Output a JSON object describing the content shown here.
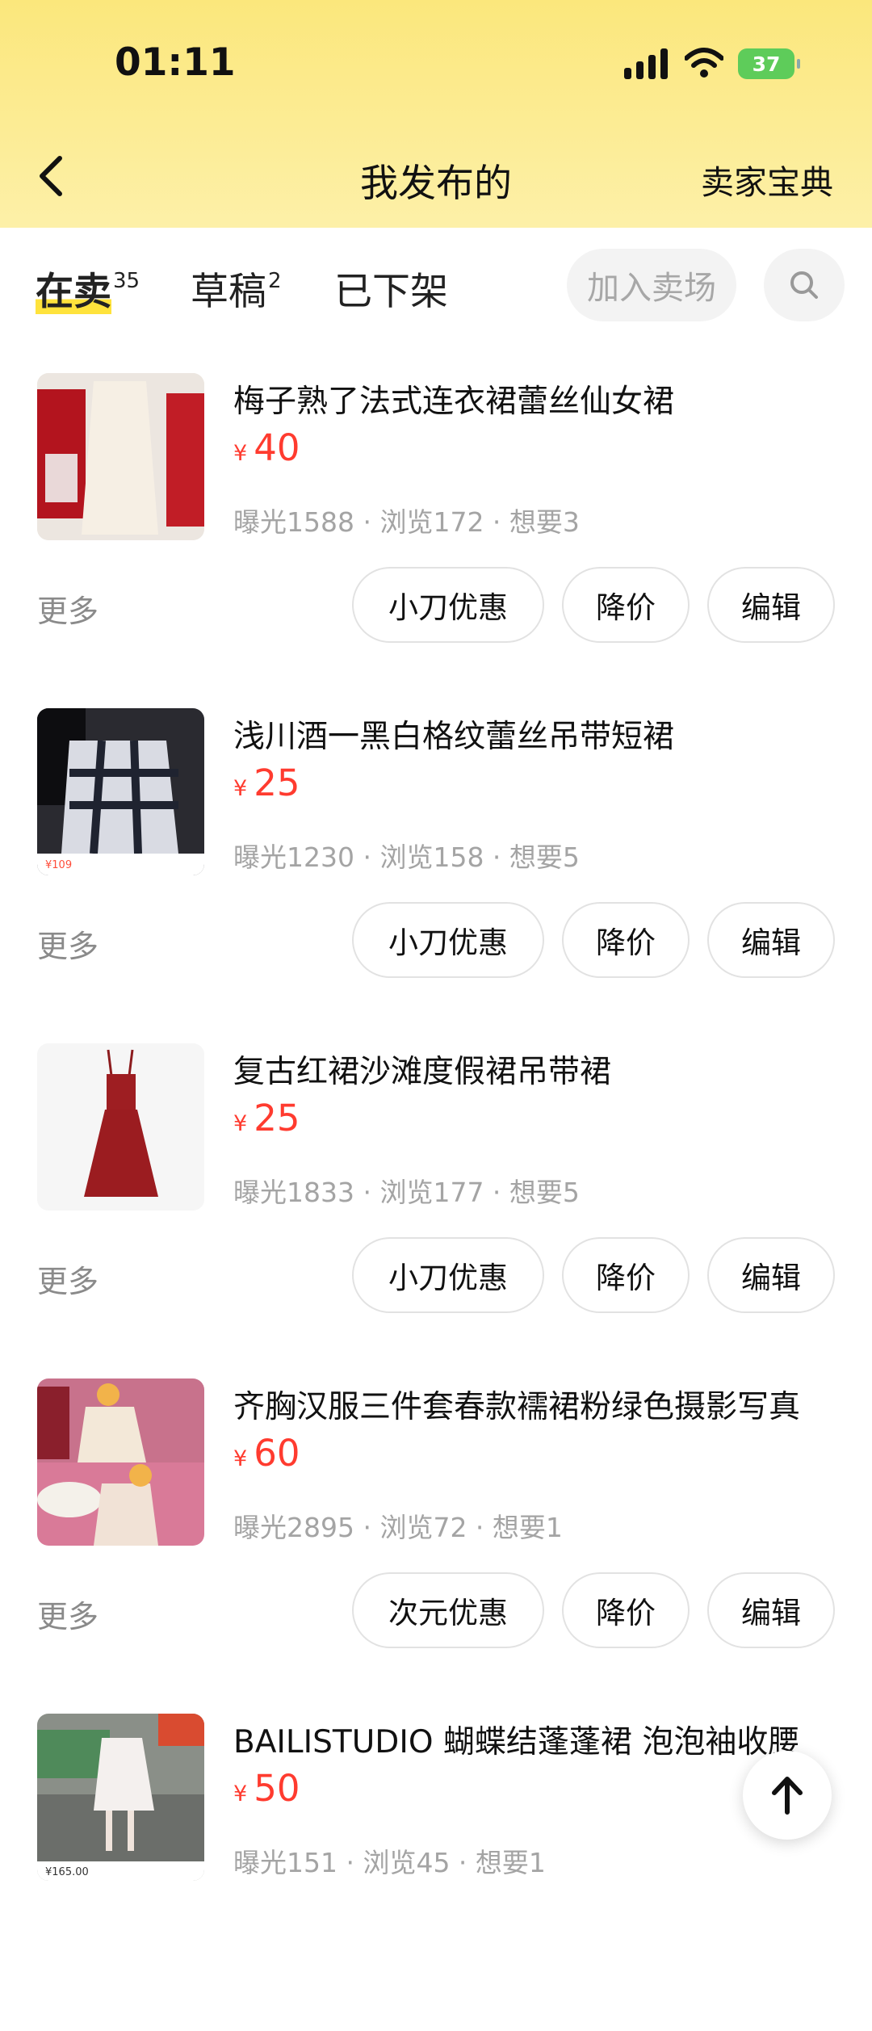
{
  "status_bar": {
    "time": "01:11",
    "battery": "37"
  },
  "header": {
    "title": "我发布的",
    "seller_guide": "卖家宝典"
  },
  "tabs": [
    {
      "label": "在卖",
      "count": "35"
    },
    {
      "label": "草稿",
      "count": "2"
    },
    {
      "label": "已下架",
      "count": ""
    }
  ],
  "actions": {
    "join_market": "加入卖场"
  },
  "items": [
    {
      "title": "梅子熟了法式连衣裙蕾丝仙女裙",
      "currency": "¥",
      "price": "40",
      "stats": "曝光1588 · 浏览172 · 想要3",
      "more": "更多",
      "buttons": [
        "小刀优惠",
        "降价",
        "编辑"
      ]
    },
    {
      "title": "浅川酒一黑白格纹蕾丝吊带短裙",
      "currency": "¥",
      "price": "25",
      "stats": "曝光1230 · 浏览158 · 想要5",
      "more": "更多",
      "buttons": [
        "小刀优惠",
        "降价",
        "编辑"
      ],
      "thumb_tag": "¥109"
    },
    {
      "title": "复古红裙沙滩度假裙吊带裙",
      "currency": "¥",
      "price": "25",
      "stats": "曝光1833 · 浏览177 · 想要5",
      "more": "更多",
      "buttons": [
        "小刀优惠",
        "降价",
        "编辑"
      ]
    },
    {
      "title": "齐胸汉服三件套春款襦裙粉绿色摄影写真",
      "currency": "¥",
      "price": "60",
      "stats": "曝光2895 · 浏览72 · 想要1",
      "more": "更多",
      "buttons": [
        "次元优惠",
        "降价",
        "编辑"
      ]
    },
    {
      "title": "BAILISTUDIO 蝴蝶结蓬蓬裙 泡泡袖收腰",
      "currency": "¥",
      "price": "50",
      "stats": "曝光151 · 浏览45 · 想要1",
      "thumb_tag": "¥165.00"
    }
  ]
}
